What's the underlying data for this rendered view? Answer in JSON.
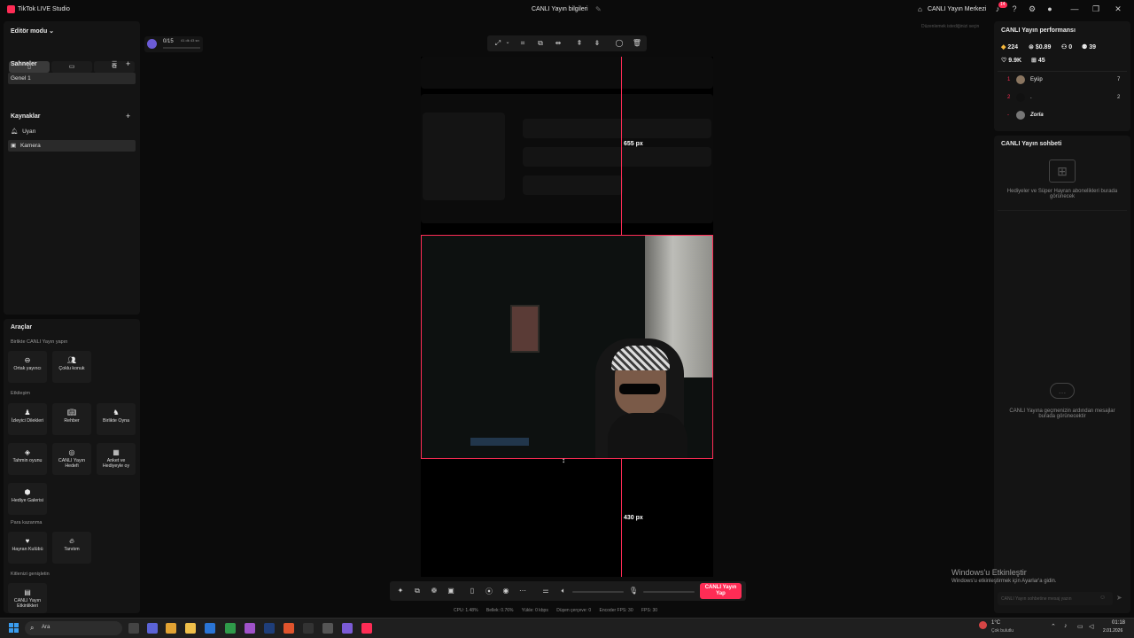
{
  "titlebar": {
    "app_name": "TikTok LIVE Studio",
    "center_title": "CANLI Yayın bilgileri",
    "live_center": "CANLI Yayın Merkezi",
    "notification_count": "14"
  },
  "left": {
    "editor_mode": "Editör modu",
    "scenes_title": "Sahneler",
    "scenes": [
      "Genel 1"
    ],
    "sources_title": "Kaynaklar",
    "sources": [
      "Uyarı",
      "Kamera"
    ],
    "tools_title": "Araçlar",
    "sections": {
      "together": "Birlikte CANLI Yayın yapın",
      "engagement": "Etkileşim",
      "earn": "Para kazanma",
      "expand": "Kitlenizi genişletin"
    },
    "tools_together": [
      "Ortak yayıncı",
      "Çoklu konuk"
    ],
    "tools_engagement": [
      "İzleyici Dilekleri",
      "Rehber",
      "Birlikte Oyna",
      "Tahmin oyunu",
      "CANLI Yayın Hedefi",
      "Anket ve Hediyeyle oy",
      "Hediye Galerisi"
    ],
    "tools_earn": [
      "Hayran Kulübü",
      "Tanıtım"
    ],
    "tools_expand": [
      "CANLI Yayın Etkinlikleri"
    ]
  },
  "widget": {
    "counter": "0/15",
    "sublabel": "41 dk 43 sn"
  },
  "canvas": {
    "top_distance": "655 px",
    "bottom_distance": "430 px",
    "hint": "Düzenlemek istediğinizi seçin"
  },
  "bottom": {
    "go_live": "CANLI Yayın Yap",
    "stats": [
      "CPU: 1.48%",
      "Bellek: 0.76%",
      "Yükle: 0 kbps",
      "Düşen çerçeve: 0",
      "Encoder FPS: 30",
      "FPS: 30"
    ]
  },
  "right": {
    "perf_title": "CANLI Yayın performansı",
    "metrics": {
      "diamonds": "224",
      "money": "$0.89",
      "viewers": "0",
      "shares": "39",
      "likes": "9.9K",
      "gifts": "45"
    },
    "leaderboard": [
      {
        "rank": "1",
        "name": "Eyüp",
        "score": "7"
      },
      {
        "rank": "2",
        "name": ".",
        "score": "2"
      },
      {
        "rank": "-",
        "name": "Zorla",
        "score": ""
      }
    ],
    "chat_title": "CANLI Yayın sohbeti",
    "gift_note": "Hediyeler ve Süper Hayran abonelikleri burada görünecek",
    "chat_note": "CANLI Yayına geçmenizin ardından mesajlar burada görünecektir",
    "chat_placeholder": "CANLI Yayın sohbetine mesaj yazın"
  },
  "watermark": {
    "title": "Windows'u Etkinleştir",
    "sub": "Windows'u etkinleştirmek için Ayarlar'a gidin."
  },
  "taskbar": {
    "search": "Ara",
    "weather_temp": "1°C",
    "weather_desc": "Çok bulutlu",
    "time": "01:18",
    "date": "2.01.2026"
  },
  "colors": {
    "accent": "#fe2c55",
    "bg": "#0b0b0b",
    "panel": "#141414"
  }
}
